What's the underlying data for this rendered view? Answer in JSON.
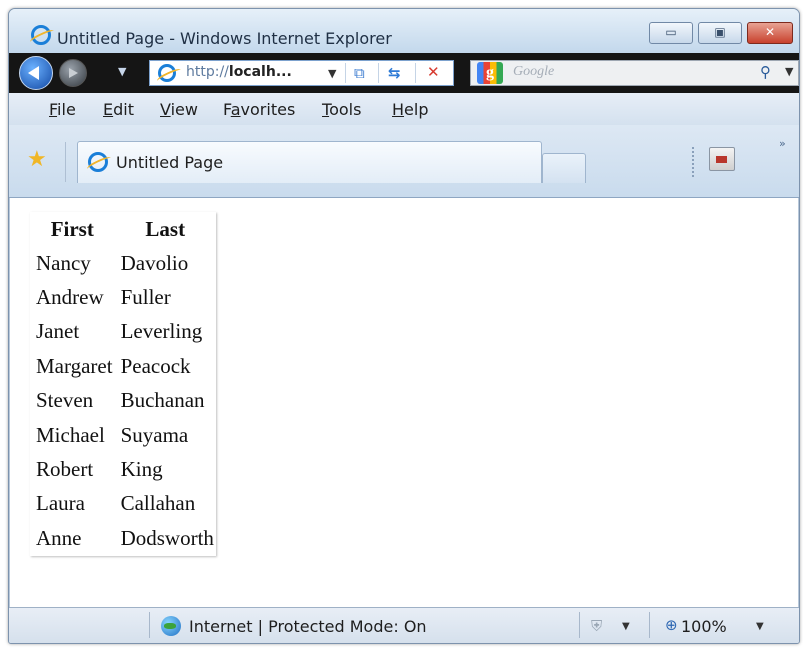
{
  "window": {
    "title": "Untitled Page - Windows Internet Explorer",
    "minimize_glyph": "▭",
    "maximize_glyph": "▣",
    "close_glyph": "✕"
  },
  "navbar": {
    "address_scheme": "http://",
    "address_host": "localh...",
    "search_placeholder": "Google",
    "search_engine_logo": "g"
  },
  "menu": {
    "items": [
      {
        "first": "F",
        "rest": "ile"
      },
      {
        "first": "E",
        "rest": "dit"
      },
      {
        "first": "V",
        "rest": "iew"
      },
      {
        "pre": "F",
        "first": "a",
        "rest": "vorites"
      },
      {
        "first": "T",
        "rest": "ools"
      },
      {
        "first": "H",
        "rest": "elp"
      }
    ]
  },
  "tabs": {
    "active_label": "Untitled Page",
    "chevron": "»"
  },
  "grid": {
    "headers": [
      "First",
      "Last"
    ],
    "rows": [
      [
        "Nancy",
        "Davolio"
      ],
      [
        "Andrew",
        "Fuller"
      ],
      [
        "Janet",
        "Leverling"
      ],
      [
        "Margaret",
        "Peacock"
      ],
      [
        "Steven",
        "Buchanan"
      ],
      [
        "Michael",
        "Suyama"
      ],
      [
        "Robert",
        "King"
      ],
      [
        "Laura",
        "Callahan"
      ],
      [
        "Anne",
        "Dodsworth"
      ]
    ]
  },
  "statusbar": {
    "zone_text": "Internet | Protected Mode: On",
    "zoom": "100%"
  },
  "colors": {
    "title_gradient_top": "#e6f0f9",
    "nav_background": "#151515",
    "close_button": "#c8412d"
  }
}
